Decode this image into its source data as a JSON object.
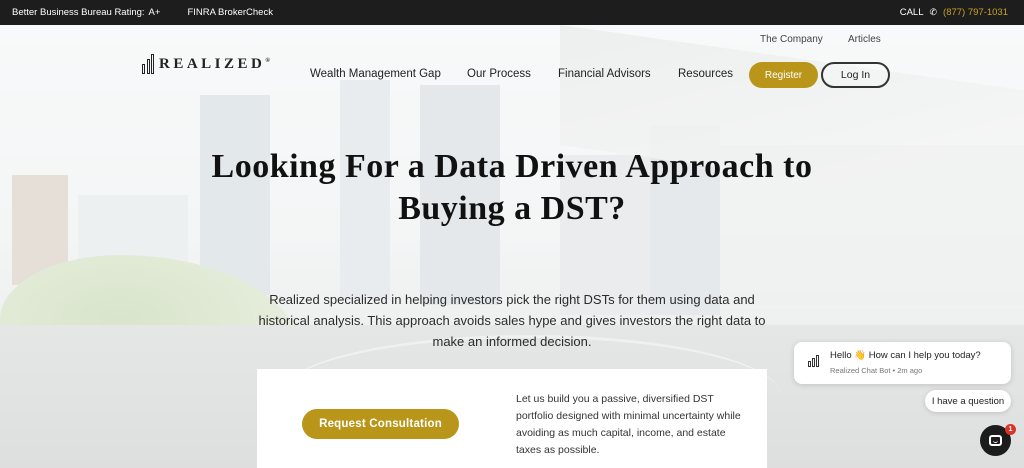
{
  "topbar": {
    "bbb_label": "Better Business Bureau Rating:",
    "bbb_value": "A+",
    "finra": "FINRA BrokerCheck",
    "call_label": "CALL",
    "phone_icon": "phone-icon",
    "phone": "(877) 797-1031"
  },
  "header": {
    "logo_text": "REALIZED",
    "logo_mark": "®",
    "subnav": [
      "The Company",
      "Articles"
    ],
    "nav": [
      "Wealth Management Gap",
      "Our Process",
      "Financial Advisors",
      "Resources"
    ],
    "register": "Register",
    "login": "Log In"
  },
  "hero": {
    "title_line1": "Looking For a Data Driven Approach to",
    "title_line2": "Buying a DST?",
    "description": "Realized specialized in helping investors pick the right DSTs for them using data and historical analysis. This approach avoids sales hype and gives investors the right data to make an informed decision."
  },
  "card": {
    "button": "Request Consultation",
    "text": "Let us build you a passive, diversified DST portfolio designed with minimal uncertainty while avoiding as much capital, income, and estate taxes as possible."
  },
  "chat": {
    "message": "Hello 👋 How can I help you today?",
    "meta": "Realized Chat Bot • 2m ago",
    "quick_reply": "I have a question",
    "badge_count": "1"
  },
  "colors": {
    "accent": "#b9961a",
    "phone": "#c9a227",
    "topbar": "#1d1d1d"
  }
}
